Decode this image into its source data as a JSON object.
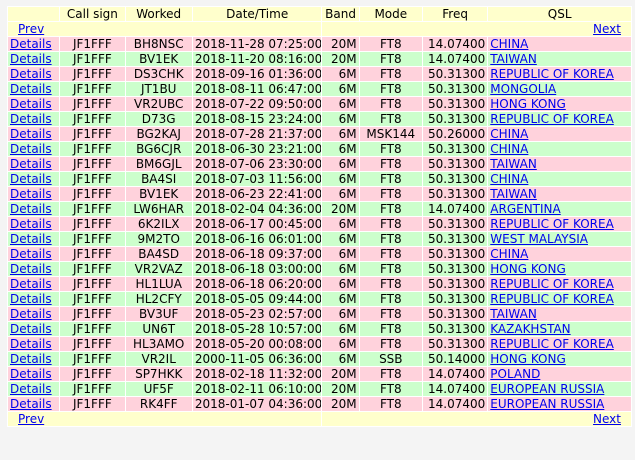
{
  "nav": {
    "prev": "Prev",
    "next": "Next"
  },
  "columns": [
    "",
    "Call sign",
    "Worked",
    "Date/Time",
    "Band",
    "Mode",
    "Freq",
    "QSL"
  ],
  "details_label": "Details",
  "rows": [
    {
      "call": "JF1FFF",
      "worked": "BH8NSC",
      "datetime": "2018-11-28 07:25:00",
      "band": "20M",
      "mode": "FT8",
      "freq": "14.07400",
      "qsl": "CHINA",
      "color": "pink"
    },
    {
      "call": "JF1FFF",
      "worked": "BV1EK",
      "datetime": "2018-11-20 08:16:00",
      "band": "20M",
      "mode": "FT8",
      "freq": "14.07400",
      "qsl": "TAIWAN",
      "color": "green"
    },
    {
      "call": "JF1FFF",
      "worked": "DS3CHK",
      "datetime": "2018-09-16 01:36:00",
      "band": "6M",
      "mode": "FT8",
      "freq": "50.31300",
      "qsl": "REPUBLIC OF KOREA",
      "color": "pink"
    },
    {
      "call": "JF1FFF",
      "worked": "JT1BU",
      "datetime": "2018-08-11 06:47:00",
      "band": "6M",
      "mode": "FT8",
      "freq": "50.31300",
      "qsl": "MONGOLIA",
      "color": "green"
    },
    {
      "call": "JF1FFF",
      "worked": "VR2UBC",
      "datetime": "2018-07-22 09:50:00",
      "band": "6M",
      "mode": "FT8",
      "freq": "50.31300",
      "qsl": "HONG KONG",
      "color": "pink"
    },
    {
      "call": "JF1FFF",
      "worked": "D73G",
      "datetime": "2018-08-15 23:24:00",
      "band": "6M",
      "mode": "FT8",
      "freq": "50.31300",
      "qsl": "REPUBLIC OF KOREA",
      "color": "green"
    },
    {
      "call": "JF1FFF",
      "worked": "BG2KAJ",
      "datetime": "2018-07-28 21:37:00",
      "band": "6M",
      "mode": "MSK144",
      "freq": "50.26000",
      "qsl": "CHINA",
      "color": "pink"
    },
    {
      "call": "JF1FFF",
      "worked": "BG6CJR",
      "datetime": "2018-06-30 23:21:00",
      "band": "6M",
      "mode": "FT8",
      "freq": "50.31300",
      "qsl": "CHINA",
      "color": "green"
    },
    {
      "call": "JF1FFF",
      "worked": "BM6GJL",
      "datetime": "2018-07-06 23:30:00",
      "band": "6M",
      "mode": "FT8",
      "freq": "50.31300",
      "qsl": "TAIWAN",
      "color": "pink"
    },
    {
      "call": "JF1FFF",
      "worked": "BA4SI",
      "datetime": "2018-07-03 11:56:00",
      "band": "6M",
      "mode": "FT8",
      "freq": "50.31300",
      "qsl": "CHINA",
      "color": "green"
    },
    {
      "call": "JF1FFF",
      "worked": "BV1EK",
      "datetime": "2018-06-23 22:41:00",
      "band": "6M",
      "mode": "FT8",
      "freq": "50.31300",
      "qsl": "TAIWAN",
      "color": "pink"
    },
    {
      "call": "JF1FFF",
      "worked": "LW6HAR",
      "datetime": "2018-02-04 04:36:00",
      "band": "20M",
      "mode": "FT8",
      "freq": "14.07400",
      "qsl": "ARGENTINA",
      "color": "green"
    },
    {
      "call": "JF1FFF",
      "worked": "6K2ILX",
      "datetime": "2018-06-17 00:45:00",
      "band": "6M",
      "mode": "FT8",
      "freq": "50.31300",
      "qsl": "REPUBLIC OF KOREA",
      "color": "pink"
    },
    {
      "call": "JF1FFF",
      "worked": "9M2TO",
      "datetime": "2018-06-16 06:01:00",
      "band": "6M",
      "mode": "FT8",
      "freq": "50.31300",
      "qsl": "WEST MALAYSIA",
      "color": "green"
    },
    {
      "call": "JF1FFF",
      "worked": "BA4SD",
      "datetime": "2018-06-18 09:37:00",
      "band": "6M",
      "mode": "FT8",
      "freq": "50.31300",
      "qsl": "CHINA",
      "color": "pink"
    },
    {
      "call": "JF1FFF",
      "worked": "VR2VAZ",
      "datetime": "2018-06-18 03:00:00",
      "band": "6M",
      "mode": "FT8",
      "freq": "50.31300",
      "qsl": "HONG KONG",
      "color": "green"
    },
    {
      "call": "JF1FFF",
      "worked": "HL1LUA",
      "datetime": "2018-06-18 06:20:00",
      "band": "6M",
      "mode": "FT8",
      "freq": "50.31300",
      "qsl": "REPUBLIC OF KOREA",
      "color": "pink"
    },
    {
      "call": "JF1FFF",
      "worked": "HL2CFY",
      "datetime": "2018-05-05 09:44:00",
      "band": "6M",
      "mode": "FT8",
      "freq": "50.31300",
      "qsl": "REPUBLIC OF KOREA",
      "color": "green"
    },
    {
      "call": "JF1FFF",
      "worked": "BV3UF",
      "datetime": "2018-05-23 02:57:00",
      "band": "6M",
      "mode": "FT8",
      "freq": "50.31300",
      "qsl": "TAIWAN",
      "color": "pink"
    },
    {
      "call": "JF1FFF",
      "worked": "UN6T",
      "datetime": "2018-05-28 10:57:00",
      "band": "6M",
      "mode": "FT8",
      "freq": "50.31300",
      "qsl": "KAZAKHSTAN",
      "color": "green"
    },
    {
      "call": "JF1FFF",
      "worked": "HL3AMO",
      "datetime": "2018-05-20 00:08:00",
      "band": "6M",
      "mode": "FT8",
      "freq": "50.31300",
      "qsl": "REPUBLIC OF KOREA",
      "color": "pink"
    },
    {
      "call": "JF1FFF",
      "worked": "VR2IL",
      "datetime": "2000-11-05 06:36:00",
      "band": "6M",
      "mode": "SSB",
      "freq": "50.14000",
      "qsl": "HONG KONG",
      "color": "green"
    },
    {
      "call": "JF1FFF",
      "worked": "SP7HKK",
      "datetime": "2018-02-18 11:32:00",
      "band": "20M",
      "mode": "FT8",
      "freq": "14.07400",
      "qsl": "POLAND",
      "color": "pink"
    },
    {
      "call": "JF1FFF",
      "worked": "UF5F",
      "datetime": "2018-02-11 06:10:00",
      "band": "20M",
      "mode": "FT8",
      "freq": "14.07400",
      "qsl": "EUROPEAN RUSSIA",
      "color": "green"
    },
    {
      "call": "JF1FFF",
      "worked": "RK4FF",
      "datetime": "2018-01-07 04:36:00",
      "band": "20M",
      "mode": "FT8",
      "freq": "14.07400",
      "qsl": "EUROPEAN RUSSIA",
      "color": "pink"
    }
  ]
}
